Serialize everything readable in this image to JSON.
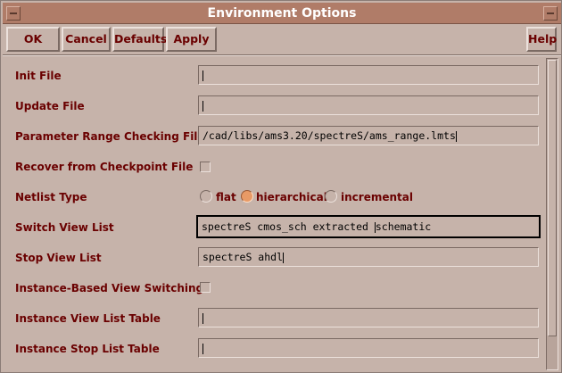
{
  "window": {
    "title": "Environment Options"
  },
  "toolbar": {
    "ok": "OK",
    "cancel": "Cancel",
    "defaults": "Defaults",
    "apply": "Apply",
    "help": "Help"
  },
  "form": {
    "init_file": {
      "label": "Init File",
      "value": ""
    },
    "update_file": {
      "label": "Update File",
      "value": ""
    },
    "param_range": {
      "label": "Parameter Range Checking File",
      "value": "/cad/libs/ams3.20/spectreS/ams_range.lmts"
    },
    "recover": {
      "label": "Recover from Checkpoint File",
      "checked": false
    },
    "netlist_type": {
      "label": "Netlist Type",
      "options": [
        "flat",
        "hierarchical",
        "incremental"
      ],
      "selected": "hierarchical"
    },
    "switch_view": {
      "label": "Switch View List",
      "value_before": "spectreS cmos_sch extracted ",
      "value_after": "schematic"
    },
    "stop_view": {
      "label": "Stop View List",
      "value": "spectreS ahdl"
    },
    "instance_switch": {
      "label": "Instance-Based View Switching",
      "checked": false
    },
    "instance_view_table": {
      "label": "Instance View List Table",
      "value": ""
    },
    "instance_stop_table": {
      "label": "Instance Stop List Table",
      "value": ""
    }
  },
  "colors": {
    "background": "#c6b3aa",
    "titlebar": "#b07c68",
    "label_text": "#6a0000",
    "radio_selected": "#e89a66"
  }
}
